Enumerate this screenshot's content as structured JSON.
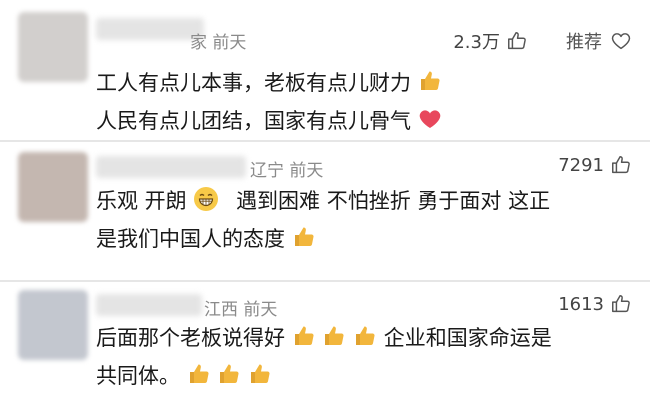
{
  "comments": [
    {
      "location_time": "家 前天",
      "likes": "2.3万",
      "recommend_label": "推荐",
      "lines": [
        "工人有点儿本事，老板有点儿财力",
        "人民有点儿团结，国家有点儿骨气"
      ]
    },
    {
      "location_time": "辽宁 前天",
      "likes": "7291",
      "lines": [
        "乐观 开朗",
        "遇到困难 不怕挫折 勇于面对 这正",
        "是我们中国人的态度"
      ]
    },
    {
      "location_time": "江西 前天",
      "likes": "1613",
      "lines": [
        "后面那个老板说得好",
        "企业和国家命运是",
        "共同体。"
      ]
    }
  ],
  "icons": {
    "like": "thumb-up-outline-icon",
    "recommend": "heart-outline-icon",
    "emoji_thumb": "thumbs-up-emoji",
    "emoji_heart": "red-heart-emoji",
    "emoji_grin": "grinning-face-emoji"
  },
  "colors": {
    "thumb_emoji": "#f2b63c",
    "heart_emoji": "#e8475c",
    "meta_text": "#8a8a8a"
  }
}
